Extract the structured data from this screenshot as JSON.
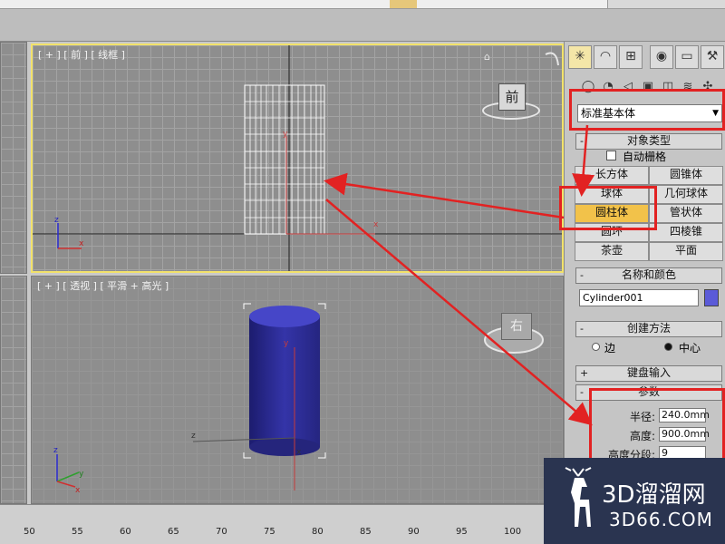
{
  "topbar": {
    "segments": 6
  },
  "viewports": {
    "front": {
      "label": "[ + ] [ 前 ] [ 线框 ]",
      "viewcube_label": "前"
    },
    "perspective": {
      "label": "[ + ] [ 透视 ] [ 平滑 + 高光 ]",
      "viewcube_label": "右"
    }
  },
  "axes": {
    "x": "x",
    "y": "y",
    "z": "z"
  },
  "panel": {
    "tabs": [
      "create-icon",
      "modify-icon",
      "hierarchy-icon",
      "motion-icon",
      "display-icon",
      "utilities-icon"
    ],
    "subtabs": [
      "geometry-icon",
      "shapes-icon",
      "lights-icon",
      "cameras-icon",
      "helpers-icon",
      "spacewarps-icon",
      "systems-icon"
    ],
    "dropdown": "标准基本体",
    "object_type": {
      "header": "对象类型",
      "autogrid": "自动栅格",
      "buttons": [
        "长方体",
        "圆锥体",
        "球体",
        "几何球体",
        "圆柱体",
        "管状体",
        "圆环",
        "四棱锥",
        "茶壶",
        "平面"
      ]
    },
    "name_color": {
      "header": "名称和颜色",
      "name": "Cylinder001",
      "color": "#5a5ad8"
    },
    "creation_method": {
      "header": "创建方法",
      "options": [
        "边",
        "中心"
      ],
      "selected": "中心"
    },
    "keyboard_entry": {
      "header": "键盘输入"
    },
    "parameters": {
      "header": "参数",
      "radius_label": "半径:",
      "radius": "240.0mm",
      "height_label": "高度:",
      "height": "900.0mm",
      "height_segments_label": "高度分段:",
      "height_segments": "9"
    }
  },
  "ruler": {
    "ticks": [
      "50",
      "55",
      "60",
      "65",
      "70",
      "75",
      "80",
      "85",
      "90",
      "95",
      "100"
    ]
  },
  "watermark": {
    "title": "3D溜溜网",
    "url": "3D66.COM"
  },
  "colors": {
    "active_viewport": "#f2e26a",
    "active_button": "#f2c24a",
    "annotation": "#e22222",
    "cylinder": "#3434a8"
  }
}
